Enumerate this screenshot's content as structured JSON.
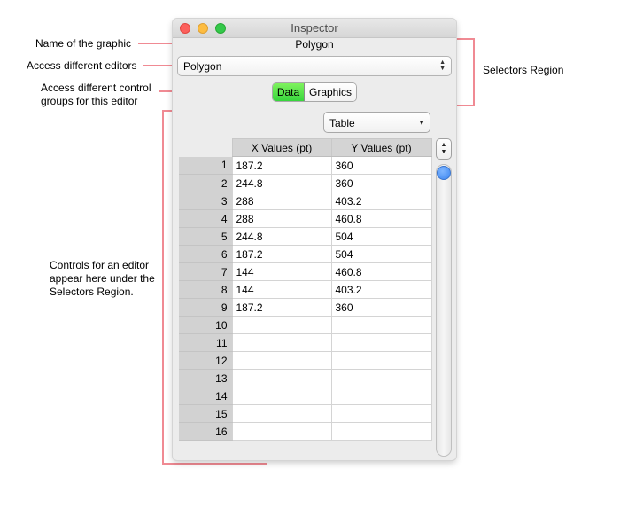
{
  "annotations": {
    "name_of_graphic": "Name of the graphic",
    "access_editors": "Access different editors",
    "access_control_groups": "Access different control groups for this editor",
    "selectors_region": "Selectors Region",
    "controls_editor": "Controls for an editor appear here under the Selectors Region."
  },
  "window": {
    "title": "Inspector",
    "graphic_name": "Polygon",
    "editor_popup": {
      "value": "Polygon",
      "icon": "updown-arrows-icon"
    },
    "control_groups": [
      "Data",
      "Graphics"
    ],
    "selected_group": "Data",
    "view_popup": {
      "value": "Table"
    },
    "table": {
      "columns": [
        "X Values (pt)",
        "Y Values (pt)"
      ],
      "rows": [
        {
          "n": "1",
          "x": "187.2",
          "y": "360"
        },
        {
          "n": "2",
          "x": "244.8",
          "y": "360"
        },
        {
          "n": "3",
          "x": "288",
          "y": "403.2"
        },
        {
          "n": "4",
          "x": "288",
          "y": "460.8"
        },
        {
          "n": "5",
          "x": "244.8",
          "y": "504"
        },
        {
          "n": "6",
          "x": "187.2",
          "y": "504"
        },
        {
          "n": "7",
          "x": "144",
          "y": "460.8"
        },
        {
          "n": "8",
          "x": "144",
          "y": "403.2"
        },
        {
          "n": "9",
          "x": "187.2",
          "y": "360"
        },
        {
          "n": "10",
          "x": "",
          "y": ""
        },
        {
          "n": "11",
          "x": "",
          "y": ""
        },
        {
          "n": "12",
          "x": "",
          "y": ""
        },
        {
          "n": "13",
          "x": "",
          "y": ""
        },
        {
          "n": "14",
          "x": "",
          "y": ""
        },
        {
          "n": "15",
          "x": "",
          "y": ""
        },
        {
          "n": "16",
          "x": "",
          "y": ""
        }
      ]
    }
  },
  "colors": {
    "annotation_line": "#f08a93",
    "selected_segment": "#4ee04a",
    "scroll_knob": "#4a8ff0",
    "close_light": "#fc605c",
    "minimize_light": "#fdbc40",
    "zoom_light": "#34c84a"
  }
}
